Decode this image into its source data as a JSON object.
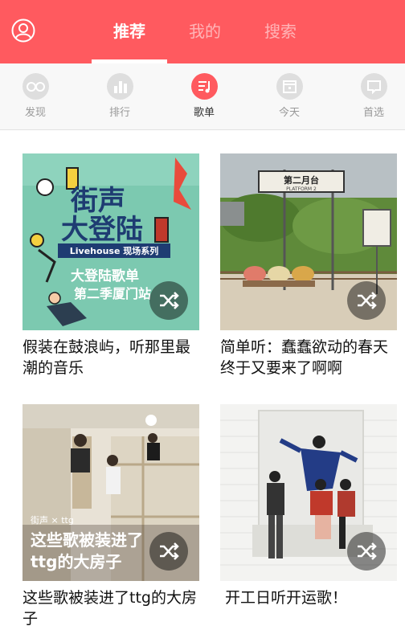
{
  "header": {
    "tabs": [
      {
        "label": "推荐",
        "active": true
      },
      {
        "label": "我的",
        "active": false
      },
      {
        "label": "搜索",
        "active": false
      }
    ],
    "accent_color": "#ff5a5f"
  },
  "categories": [
    {
      "label": "发现",
      "icon": "glasses-icon",
      "active": false
    },
    {
      "label": "排行",
      "icon": "bar-chart-icon",
      "active": false
    },
    {
      "label": "歌单",
      "icon": "music-list-icon",
      "active": true
    },
    {
      "label": "今天",
      "icon": "calendar-icon",
      "active": false
    },
    {
      "label": "首选",
      "icon": "chat-bubble-icon",
      "active": false
    }
  ],
  "playlists": [
    {
      "title": "假装在鼓浪屿，听那里最潮的音乐",
      "cover": {
        "title_line1": "街声",
        "title_line2": "大登陆",
        "subtitle": "Livehouse 现场系列",
        "caption_line1": "大登陆歌单",
        "caption_line2": "第二季厦门站"
      }
    },
    {
      "title": "简单听：蠢蠢欲动的春天终于又要来了啊啊",
      "cover": {
        "sign_text": "第二月台",
        "sign_subtext": "PLATFORM 2"
      }
    },
    {
      "title": "这些歌被装进了ttg的大房子",
      "cover": {
        "brand": "街声 × ttg",
        "caption_line1": "这些歌被装进了",
        "caption_line2": "ttg的大房子"
      }
    },
    {
      "title": "开工日听开运歌！",
      "cover": {}
    }
  ]
}
